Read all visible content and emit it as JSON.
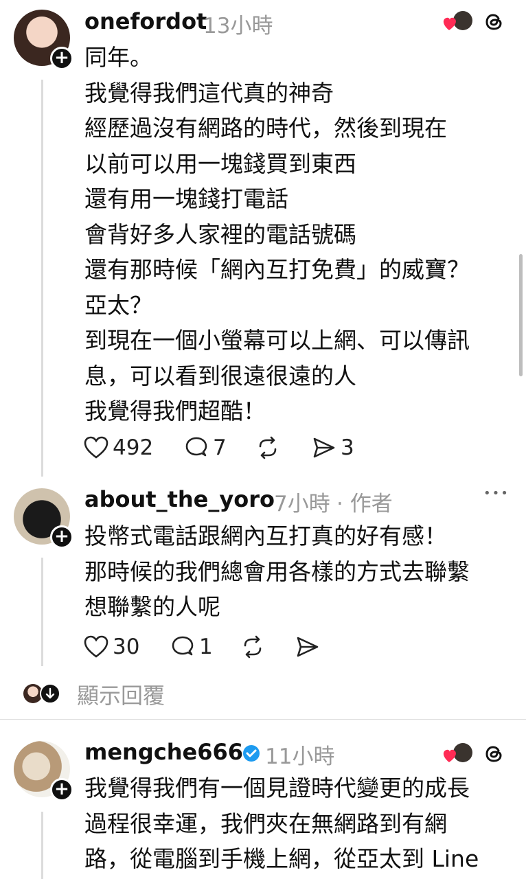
{
  "posts": [
    {
      "username": "onefordot",
      "time": "13小時",
      "lines": [
        "同年。",
        "我覺得我們這代真的神奇",
        "經歷過沒有網路的時代，然後到現在",
        "以前可以用一塊錢買到東西",
        "還有用一塊錢打電話",
        "會背好多人家裡的電話號碼",
        "還有那時候「網內互打免費」的威寶？",
        "亞太？",
        "到現在一個小螢幕可以上網、可以傳訊",
        "息，可以看到很遠很遠的人",
        "我覺得我們超酷！"
      ],
      "likes": "492",
      "replies": "7",
      "shares": "3"
    },
    {
      "username": "about_the_yoro",
      "time": "7小時",
      "tag": "· 作者",
      "more": "•••",
      "lines": [
        "投幣式電話跟網內互打真的好有感！",
        "那時候的我們總會用各樣的方式去聯繫",
        "想聯繫的人呢"
      ],
      "likes": "30",
      "replies": "1"
    },
    {
      "username": "mengche666",
      "time": "11小時",
      "lines": [
        "我覺得我們有一個見證時代變更的成長",
        "過程很幸運，我們夾在無網路到有網",
        "路，從電腦到手機上網，從亞太到 Line"
      ]
    }
  ],
  "show_replies": "顯示回覆",
  "icons": {
    "heart": "heart-icon",
    "reply": "comment-icon",
    "repost": "repost-icon",
    "share": "send-icon",
    "threads": "threads-logo-icon",
    "verified": "verified-badge-icon"
  },
  "colors": {
    "text": "#101010",
    "meta": "#999999",
    "verified": "#1d9bf0",
    "heart_badge": "#ff2b55"
  }
}
